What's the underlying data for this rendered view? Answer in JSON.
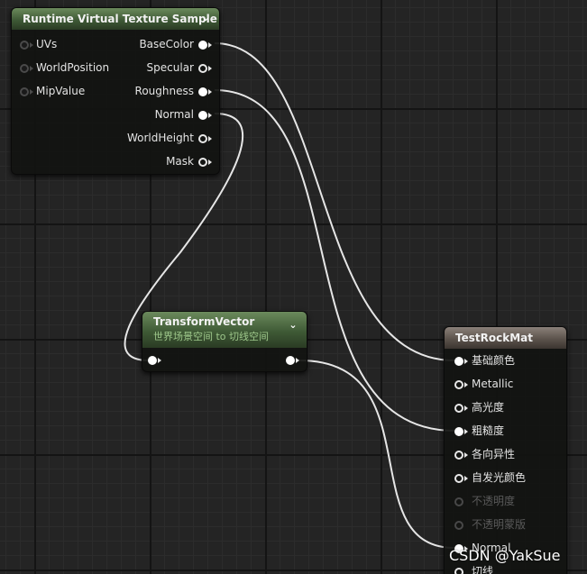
{
  "rvt_node": {
    "title": "Runtime Virtual Texture Sample",
    "inputs": [
      "UVs",
      "WorldPosition",
      "MipValue"
    ],
    "outputs": [
      "BaseColor",
      "Specular",
      "Roughness",
      "Normal",
      "WorldHeight",
      "Mask"
    ]
  },
  "transform_node": {
    "title": "TransformVector",
    "subtitle": "世界场景空间 to 切线空间"
  },
  "material_node": {
    "title": "TestRockMat",
    "inputs": [
      "基础颜色",
      "Metallic",
      "高光度",
      "粗糙度",
      "各向异性",
      "自发光颜色",
      "不透明度",
      "不透明蒙版",
      "Normal",
      "切线"
    ]
  },
  "watermark": "CSDN @YakSue",
  "colors": {
    "rvt_header": "#3f5a36",
    "material_header": "#5c534c",
    "wire": "#e6e6e6",
    "subtitle": "#9ec88b"
  }
}
